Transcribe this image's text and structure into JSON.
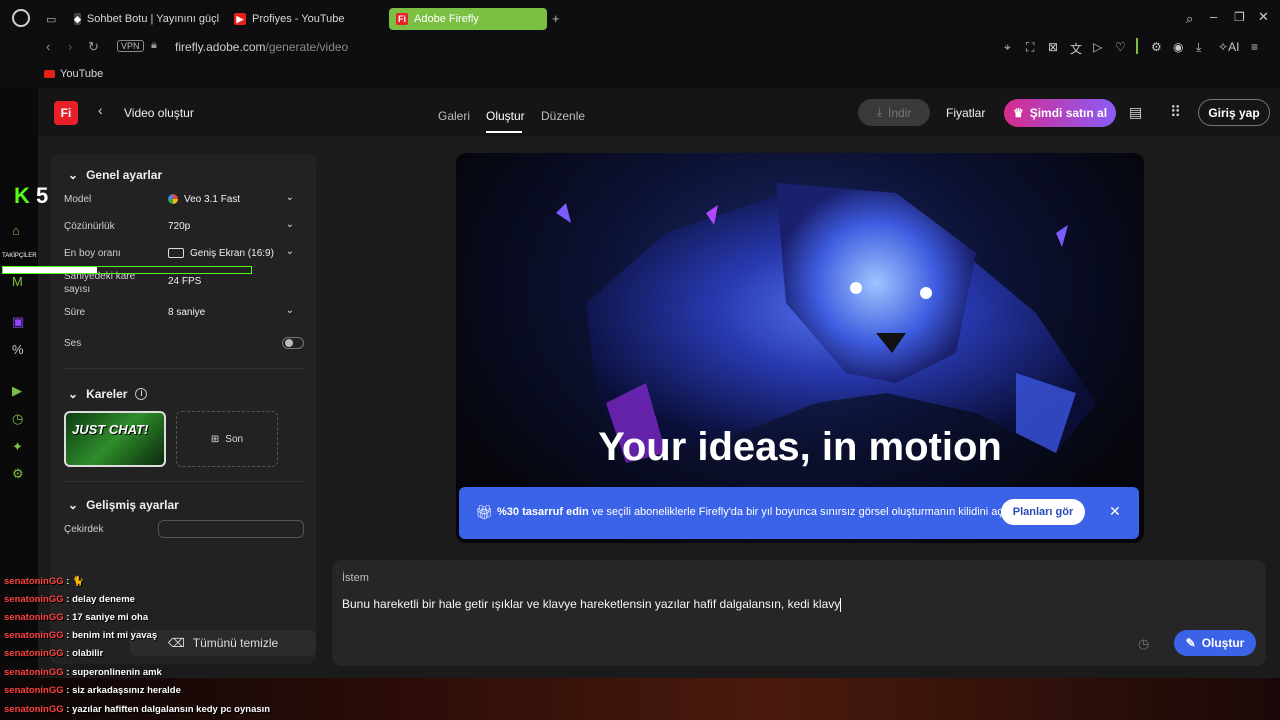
{
  "browser": {
    "tabs": [
      {
        "label": "Sohbet Botu | Yayınını güçl"
      },
      {
        "label": "Profiyes - YouTube"
      },
      {
        "label": "Adobe Firefly"
      }
    ],
    "vpn": "VPN",
    "url_host": "firefly.adobe.com",
    "url_path": "/generate/video",
    "ai_label": "AI",
    "bookmark": "YouTube"
  },
  "app": {
    "logo": "Fi",
    "title": "Video oluştur",
    "nav": [
      "Galeri",
      "Oluştur",
      "Düzenle"
    ],
    "download": "İndir",
    "pricing": "Fiyatlar",
    "buy_now": "Şimdi satın al",
    "sign_in": "Giriş yap"
  },
  "panel": {
    "general_title": "Genel ayarlar",
    "model_label": "Model",
    "model_value": "Veo 3.1 Fast",
    "resolution_label": "Çözünürlük",
    "resolution_value": "720p",
    "aspect_label": "En boy oranı",
    "aspect_value": "Geniş Ekran (16:9)",
    "fps_label": "Saniyedeki kare sayısı",
    "fps_value": "24 FPS",
    "duration_label": "Süre",
    "duration_value": "8 saniye",
    "sound_label": "Ses",
    "frames_title": "Kareler",
    "frame1_text": "JUST CHAT!",
    "frame2_label": "Son",
    "advanced_title": "Gelişmiş ayarlar",
    "seed_label": "Çekirdek",
    "clear_all": "Tümünü temizle"
  },
  "hero": {
    "title": "Your ideas, in motion"
  },
  "banner": {
    "text_bold": "%30 tasarruf edin",
    "text_rest": " ve seçili aboneliklerle Firefly'da bir yıl boyunca sınırsız görsel oluşturmanın kilidini açın.",
    "button": "Planları gör"
  },
  "prompt": {
    "label": "İstem",
    "value": "Bunu hareketli bir hale getir ışıklar ve klavye hareketlensin yazılar hafif dalgalansın, kedi klavy",
    "generate": "Oluştur"
  },
  "overlay": {
    "kick_count": "5",
    "tag_label": "TAKİPÇİLER",
    "progress": 0.38,
    "chat": [
      {
        "user": "senatoninGG",
        "msg": " : 🐈"
      },
      {
        "user": "senatoninGG",
        "msg": " : delay deneme"
      },
      {
        "user": "senatoninGG",
        "msg": " : 17 saniye mi oha"
      },
      {
        "user": "senatoninGG",
        "msg": " : benim int mi yavaş"
      },
      {
        "user": "senatoninGG",
        "msg": " : olabilir"
      },
      {
        "user": "senatoninGG",
        "msg": " : superonlinenin amk"
      },
      {
        "user": "senatoninGG",
        "msg": " : siz arkadaşsınız heralde"
      },
      {
        "user": "senatoninGG",
        "msg": " : yazılar hafiften dalgalansın kedy pc oynasın"
      }
    ]
  },
  "colors": {
    "accent_blue": "#3b63e8",
    "opera_green": "#7bc043",
    "brand_red": "#e8202a"
  }
}
